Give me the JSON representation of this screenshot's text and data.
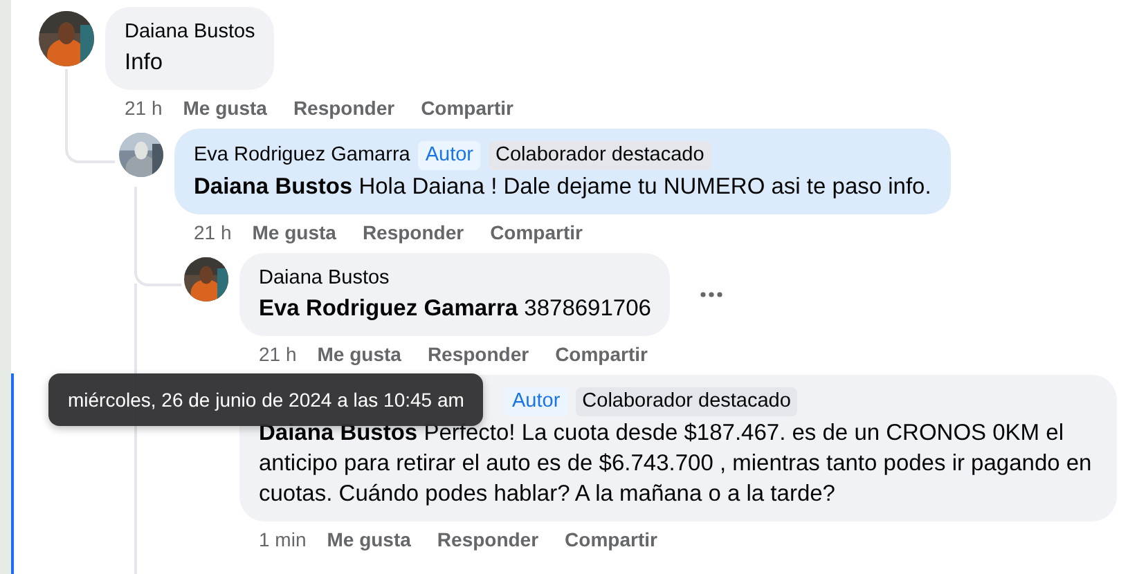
{
  "comments": [
    {
      "author": "Daiana Bustos",
      "text": "Info",
      "highlighted": false,
      "has_menu": false,
      "time": "21 h",
      "actions": [
        "Me gusta",
        "Responder",
        "Compartir"
      ],
      "children": [
        {
          "author": "Eva Rodriguez Gamarra",
          "badges": [
            {
              "label": "Autor",
              "kind": "author"
            },
            {
              "label": "Colaborador destacado",
              "kind": "featured"
            }
          ],
          "mention": "Daiana Bustos",
          "text": "Hola Daiana ! Dale dejame tu NUMERO asi te paso info.",
          "highlighted": true,
          "has_menu": false,
          "time": "21 h",
          "actions": [
            "Me gusta",
            "Responder",
            "Compartir"
          ],
          "children": [
            {
              "author": "Daiana Bustos",
              "mention": "Eva Rodriguez Gamarra",
              "text": "3878691706",
              "highlighted": false,
              "has_menu": true,
              "time": "21 h",
              "actions": [
                "Me gusta",
                "Responder",
                "Compartir"
              ]
            },
            {
              "badges": [
                {
                  "label": "Autor",
                  "kind": "author"
                },
                {
                  "label": "Colaborador destacado",
                  "kind": "featured"
                }
              ],
              "mention": "Daiana Bustos",
              "text": "Perfecto! La cuota desde $187.467. es de un CRONOS 0KM el anticipo para retirar el auto es de $6.743.700 , mientras tanto podes ir pagando en cuotas. Cuándo podes hablar? A la mañana o a la tarde?",
              "highlighted": false,
              "has_menu": false,
              "time": "1 min",
              "actions": [
                "Me gusta",
                "Responder",
                "Compartir"
              ]
            }
          ]
        }
      ]
    }
  ],
  "tooltip": "miércoles, 26 de junio de 2024 a las 10:45 am"
}
